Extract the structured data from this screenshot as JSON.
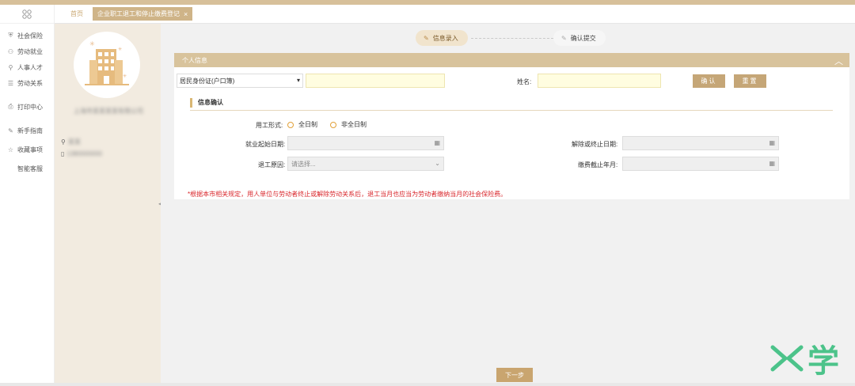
{
  "nav": {
    "items": [
      {
        "label": "社会保险",
        "icon": "shield-user-icon"
      },
      {
        "label": "劳动就业",
        "icon": "briefcase-icon"
      },
      {
        "label": "人事人才",
        "icon": "person-icon"
      },
      {
        "label": "劳动关系",
        "icon": "document-icon"
      },
      {
        "label": "打印中心",
        "icon": "printer-icon"
      },
      {
        "label": "新手指南",
        "icon": "edit-icon"
      },
      {
        "label": "收藏事项",
        "icon": "star-icon"
      },
      {
        "label": "智能客服",
        "icon": ""
      }
    ]
  },
  "tabs": {
    "home": "首页",
    "active": "企业职工退工和停止缴费登记",
    "close": "×"
  },
  "profile": {
    "company": "上海市某某某某有限公司",
    "user": "某某",
    "phone": "1380000000"
  },
  "steps": {
    "step1": "信息录入",
    "step2": "确认提交"
  },
  "form": {
    "section_title": "个人信息",
    "id_type": "居民身份证(户口簿)",
    "name_label": "姓名:",
    "confirm_btn": "确认",
    "reset_btn": "重置",
    "info_confirm": "信息确认",
    "employment_label": "用工形式:",
    "opt_full": "全日制",
    "opt_part": "非全日制",
    "start_date_label": "就业起始日期:",
    "end_date_label": "解除或终止日期:",
    "reason_label": "退工原因:",
    "reason_placeholder": "请选择...",
    "pay_end_label": "缴费截止年月:",
    "note": "*根据本市相关规定，用人单位与劳动者终止或解除劳动关系后，退工当月也应当为劳动者缴纳当月的社会保险费。",
    "next_btn": "下一步"
  },
  "colors": {
    "accent": "#cfb488",
    "note": "#d9262b"
  },
  "watermark": "学"
}
